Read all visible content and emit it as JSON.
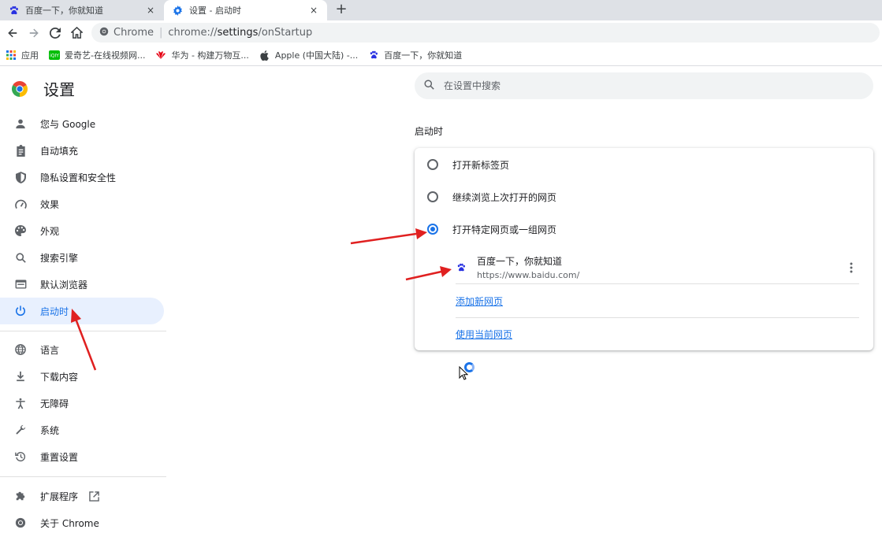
{
  "tabs": [
    {
      "title": "百度一下，你就知道",
      "close": "×"
    },
    {
      "title": "设置 - 启动时",
      "close": "×"
    }
  ],
  "newtab": "+",
  "omnibox": {
    "host": "Chrome",
    "separator": "|",
    "url_scheme": "chrome://",
    "url_path": "settings",
    "url_rest": "/onStartup"
  },
  "bookmarks": [
    {
      "label": "应用",
      "icon": "apps-grid-icon"
    },
    {
      "label": "爱奇艺-在线视频网...",
      "icon": "iqiyi-icon"
    },
    {
      "label": "华为 - 构建万物互...",
      "icon": "huawei-icon"
    },
    {
      "label": "Apple (中国大陆) -...",
      "icon": "apple-icon"
    },
    {
      "label": "百度一下，你就知道",
      "icon": "baidu-paw-icon"
    }
  ],
  "sidebar": {
    "title": "设置",
    "items": [
      {
        "label": "您与 Google",
        "icon": "person-icon"
      },
      {
        "label": "自动填充",
        "icon": "clipboard-icon"
      },
      {
        "label": "隐私设置和安全性",
        "icon": "shield-icon"
      },
      {
        "label": "效果",
        "icon": "gauge-icon"
      },
      {
        "label": "外观",
        "icon": "palette-icon"
      },
      {
        "label": "搜索引擎",
        "icon": "search-icon"
      },
      {
        "label": "默认浏览器",
        "icon": "browser-icon"
      },
      {
        "label": "启动时",
        "icon": "power-icon"
      },
      {
        "label": "语言",
        "icon": "globe-icon"
      },
      {
        "label": "下载内容",
        "icon": "download-icon"
      },
      {
        "label": "无障碍",
        "icon": "accessibility-icon"
      },
      {
        "label": "系统",
        "icon": "wrench-icon"
      },
      {
        "label": "重置设置",
        "icon": "restore-icon"
      },
      {
        "label": "扩展程序",
        "icon": "puzzle-icon"
      },
      {
        "label": "关于 Chrome",
        "icon": "chrome-icon"
      }
    ]
  },
  "search": {
    "placeholder": "在设置中搜索"
  },
  "startup": {
    "section_title": "启动时",
    "options": [
      {
        "label": "打开新标签页",
        "checked": false
      },
      {
        "label": "继续浏览上次打开的网页",
        "checked": false
      },
      {
        "label": "打开特定网页或一组网页",
        "checked": true
      }
    ],
    "pages": [
      {
        "name": "百度一下，你就知道",
        "url": "https://www.baidu.com/"
      }
    ],
    "add_page": "添加新网页",
    "use_current": "使用当前网页"
  },
  "colors": {
    "accent": "#1a73e8",
    "annotation_arrow": "#e02020"
  }
}
